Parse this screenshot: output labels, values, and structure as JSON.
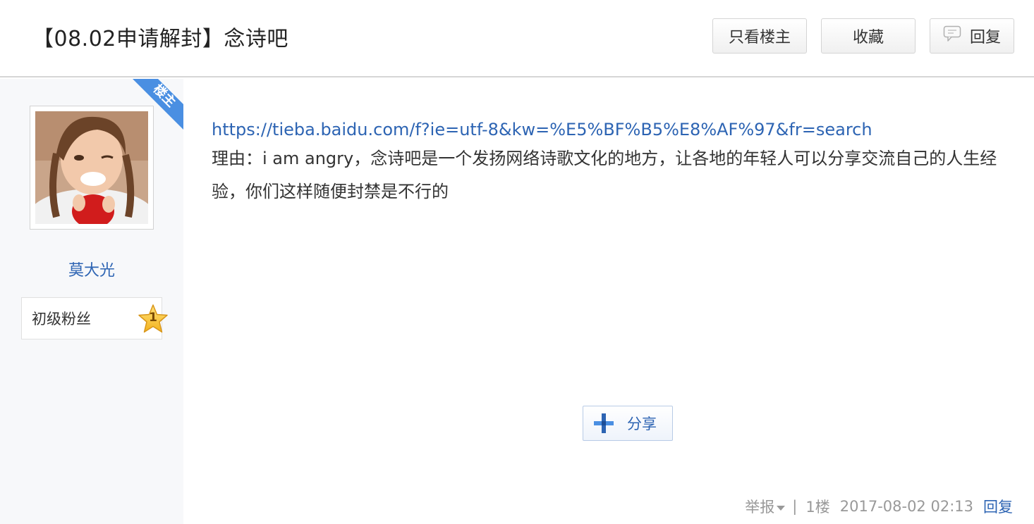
{
  "header": {
    "title": "【08.02申请解封】念诗吧",
    "buttons": {
      "author_only": "只看楼主",
      "favorite": "收藏",
      "reply": "回复"
    }
  },
  "sidebar": {
    "badge": "楼主",
    "username": "莫大光",
    "level_name": "初级粉丝",
    "level_number": "1"
  },
  "post": {
    "link": "https://tieba.baidu.com/f?ie=utf-8&kw=%E5%BF%B5%E8%AF%97&fr=search",
    "reason": "理由：i am angry，念诗吧是一个发扬网络诗歌文化的地方，让各地的年轻人可以分享交流自己的人生经验，你们这样随便封禁是不行的",
    "share_label": "分享"
  },
  "footer": {
    "report": "举报",
    "separator": "|",
    "floor": "1楼",
    "time": "2017-08-02 02:13",
    "reply": "回复"
  },
  "colors": {
    "link": "#2d64b3",
    "badge": "#4a8fe2",
    "sidebar_bg": "#f7f8fa"
  }
}
